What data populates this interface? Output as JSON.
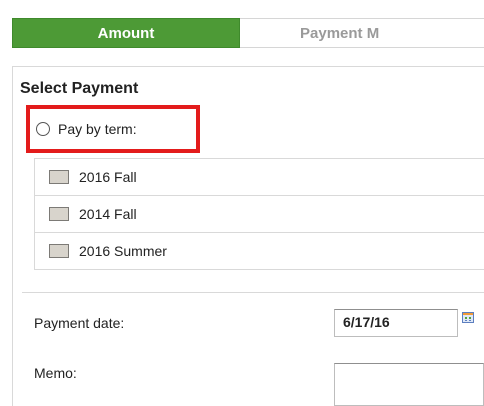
{
  "tabs": {
    "amount_label": "Amount",
    "payment_method_label": "Payment M"
  },
  "select_payment": {
    "title": "Select Payment",
    "pay_by_term_label": "Pay by term:",
    "terms": [
      {
        "label": "2016 Fall"
      },
      {
        "label": "2014 Fall"
      },
      {
        "label": "2016 Summer"
      }
    ]
  },
  "payment_date": {
    "label": "Payment date:",
    "value": "6/17/16",
    "icon": "calendar-icon"
  },
  "memo": {
    "label": "Memo:",
    "value": ""
  },
  "colors": {
    "active_tab": "#4d9a36",
    "highlight_border": "#e31b1b"
  }
}
